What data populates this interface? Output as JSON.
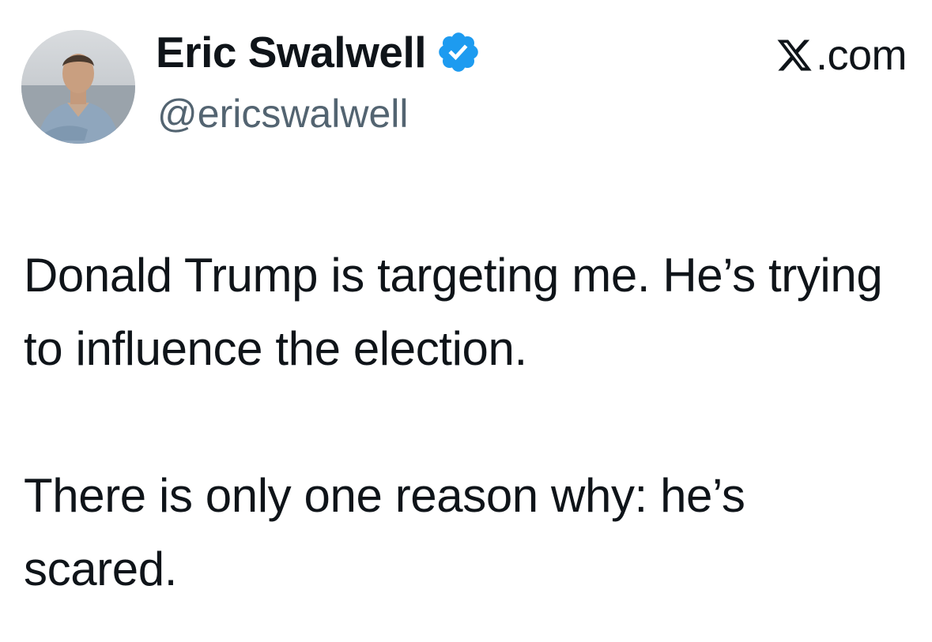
{
  "tweet": {
    "author": {
      "display_name": "Eric Swalwell",
      "handle": "@ericswalwell",
      "verified": true,
      "verified_icon": "verified-badge-icon",
      "verified_color": "#1d9bf0",
      "avatar_icon": "avatar"
    },
    "source": {
      "logo_icon": "x-logo-icon",
      "label": ".com"
    },
    "paragraphs": [
      "Donald Trump is targeting me. He’s trying to influence the election.",
      "There is only one reason why: he’s scared."
    ]
  },
  "colors": {
    "text_primary": "#0f1419",
    "text_secondary": "#536471",
    "background": "#ffffff",
    "accent": "#1d9bf0"
  }
}
